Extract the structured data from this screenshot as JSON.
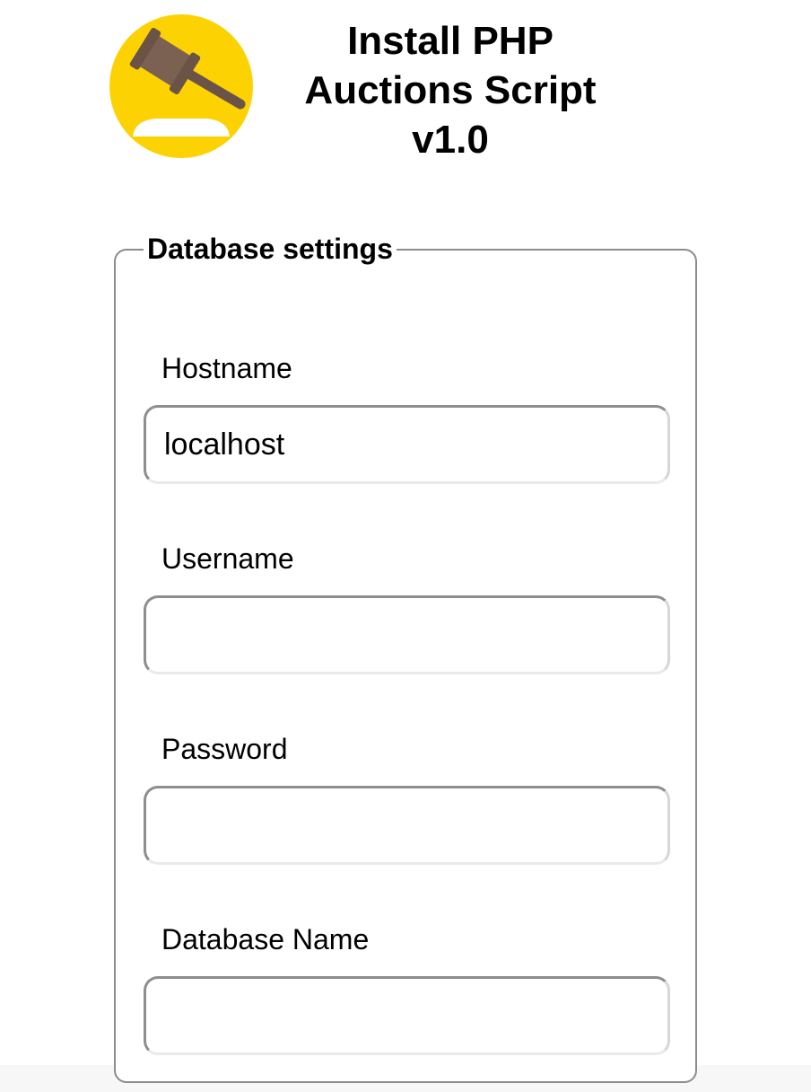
{
  "header": {
    "logo_icon": "gavel-icon",
    "logo_bg_color": "#FCD203",
    "title_lines": [
      "Install PHP",
      "Auctions Script",
      "v1.0"
    ]
  },
  "form": {
    "legend": "Database settings",
    "fields": [
      {
        "label": "Hostname",
        "value": "localhost",
        "type": "text"
      },
      {
        "label": "Username",
        "value": "",
        "type": "text"
      },
      {
        "label": "Password",
        "value": "",
        "type": "password"
      },
      {
        "label": "Database Name",
        "value": "",
        "type": "text"
      }
    ]
  }
}
